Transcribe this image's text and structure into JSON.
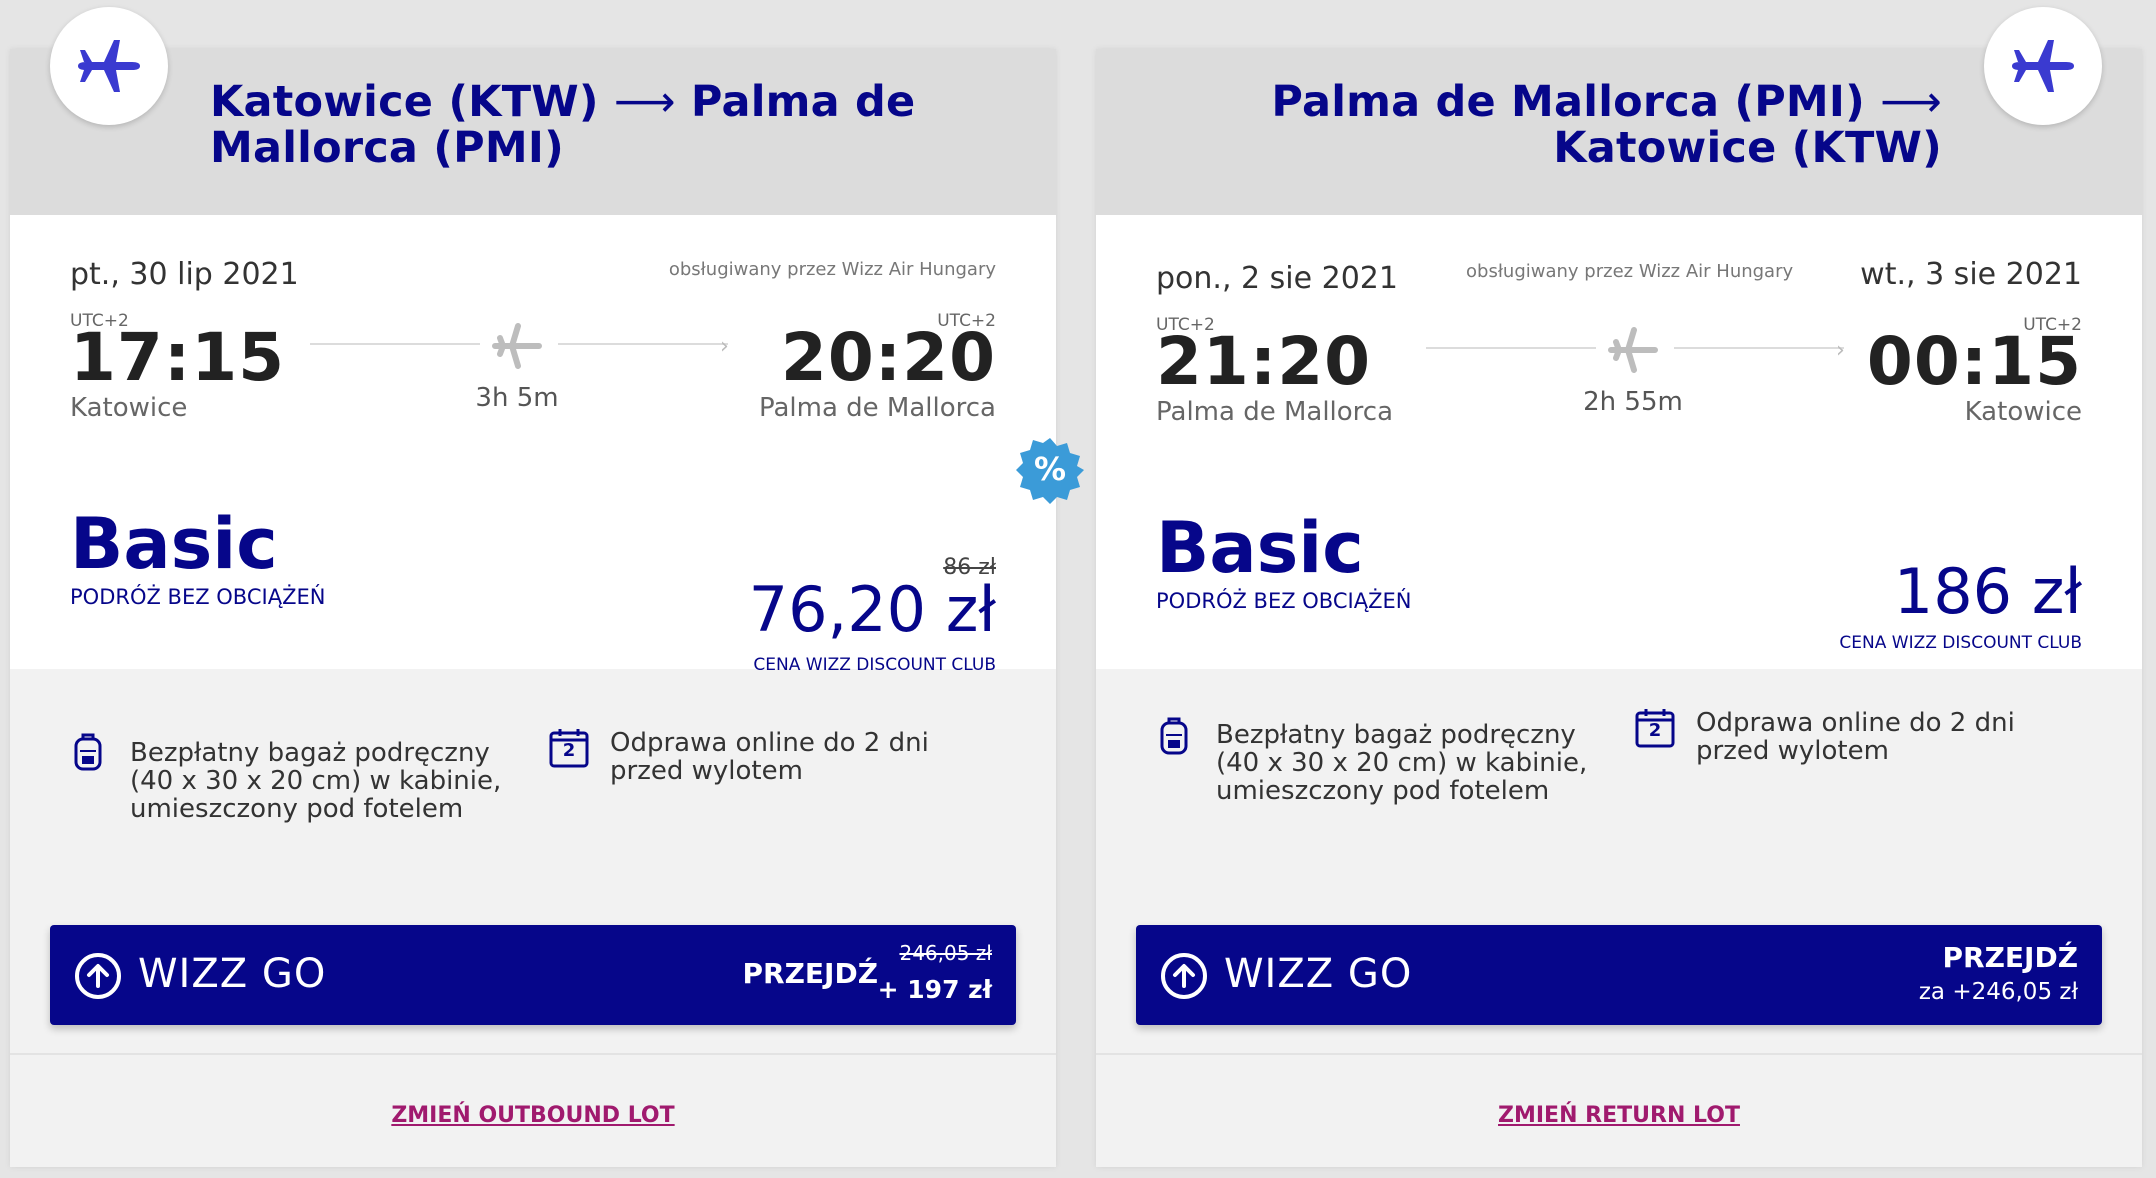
{
  "outbound": {
    "route": {
      "origin": "Katowice (KTW)",
      "arrow": "⟶",
      "destination": "Palma de Mallorca (PMI)"
    },
    "departure_date": "pt., 30 lip 2021",
    "operated_by": "obsługiwany przez Wizz Air Hungary",
    "departure_tz": "UTC+2",
    "departure_time": "17:15",
    "departure_city": "Katowice",
    "duration": "3h 5m",
    "arrival_tz": "UTC+2",
    "arrival_time": "20:20",
    "arrival_city": "Palma de Mallorca",
    "fare_name": "Basic",
    "fare_sub": "PODRÓŻ BEZ OBCIĄŻEŃ",
    "old_price": "86 zł",
    "price": "76,20 zł",
    "price_sub": "CENA WIZZ DISCOUNT CLUB",
    "perk_bag": "Bezpłatny bagaż podręczny (40 x 30 x 20 cm) w kabinie, umieszczony pod fotelem",
    "perk_checkin": "Odprawa online do 2 dni przed wylotem",
    "checkin_day": "2",
    "wizzgo_label": "WIZZ GO",
    "wizzgo_action": "PRZEJDŹ",
    "wizzgo_old": "246,05 zł",
    "wizzgo_price": "+ 197 zł",
    "change_link": "ZMIEŃ OUTBOUND LOT"
  },
  "return": {
    "route": {
      "origin": "Palma de Mallorca (PMI)",
      "arrow": "⟶",
      "destination": "Katowice (KTW)"
    },
    "departure_date": "pon., 2 sie 2021",
    "operated_by": "obsługiwany przez Wizz Air Hungary",
    "arrival_date": "wt., 3 sie 2021",
    "departure_tz": "UTC+2",
    "departure_time": "21:20",
    "departure_city": "Palma de Mallorca",
    "duration": "2h 55m",
    "arrival_tz": "UTC+2",
    "arrival_time": "00:15",
    "arrival_city": "Katowice",
    "fare_name": "Basic",
    "fare_sub": "PODRÓŻ BEZ OBCIĄŻEŃ",
    "price": "186 zł",
    "price_sub": "CENA WIZZ DISCOUNT CLUB",
    "perk_bag": "Bezpłatny bagaż podręczny (40 x 30 x 20 cm) w kabinie, umieszczony pod fotelem",
    "perk_checkin": "Odprawa online do 2 dni przed wylotem",
    "checkin_day": "2",
    "wizzgo_label": "WIZZ GO",
    "wizzgo_action": "PRZEJDŹ",
    "wizzgo_price": "za +246,05 zł",
    "change_link": "ZMIEŃ RETURN LOT"
  },
  "discount_symbol": "%",
  "colors": {
    "brand": "#06068a",
    "link": "#a01a6e",
    "discount": "#3b9bd8",
    "plane_icon": "#3a3ad0"
  }
}
